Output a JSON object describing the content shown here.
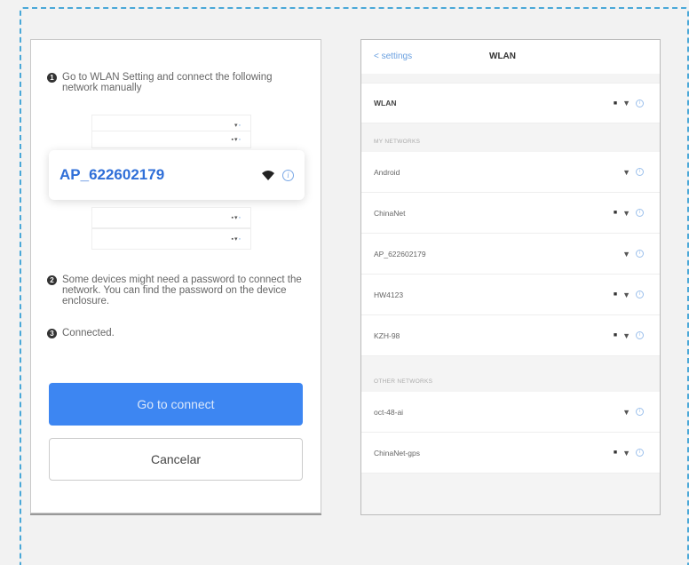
{
  "instructions": {
    "step1_num": "1",
    "step1_text": "Go to WLAN Setting and connect the following network manually",
    "step2_num": "2",
    "step2_text": "Some devices might need a password to connect the network. You can find the password on the device enclosure.",
    "step3_num": "3",
    "step3_text": "Connected."
  },
  "highlight_network": {
    "name": "AP_622602179"
  },
  "buttons": {
    "connect_label": "Go to connect",
    "cancel_label": "Cancelar"
  },
  "phone": {
    "back_label": "< settings",
    "title": "WLAN",
    "wlan_row_label": "WLAN",
    "my_networks_header": "MY NETWORKS",
    "other_networks_header": "OTHER NETWORKS",
    "my_networks": [
      {
        "name": "Android",
        "locked": false
      },
      {
        "name": "ChinaNet",
        "locked": true
      },
      {
        "name": "AP_622602179",
        "locked": false
      },
      {
        "name": "HW4123",
        "locked": true
      },
      {
        "name": "KZH-98",
        "locked": true
      }
    ],
    "other_networks": [
      {
        "name": "oct-48-ai",
        "locked": false
      },
      {
        "name": "ChinaNet-gps",
        "locked": true
      }
    ]
  },
  "icons": {
    "wifi": "wifi-icon",
    "lock": "lock-icon",
    "info": "info-icon"
  },
  "colors": {
    "accent": "#3d86f2",
    "highlight_text": "#2f6fd8",
    "dashed_border": "#4aa8d8"
  }
}
